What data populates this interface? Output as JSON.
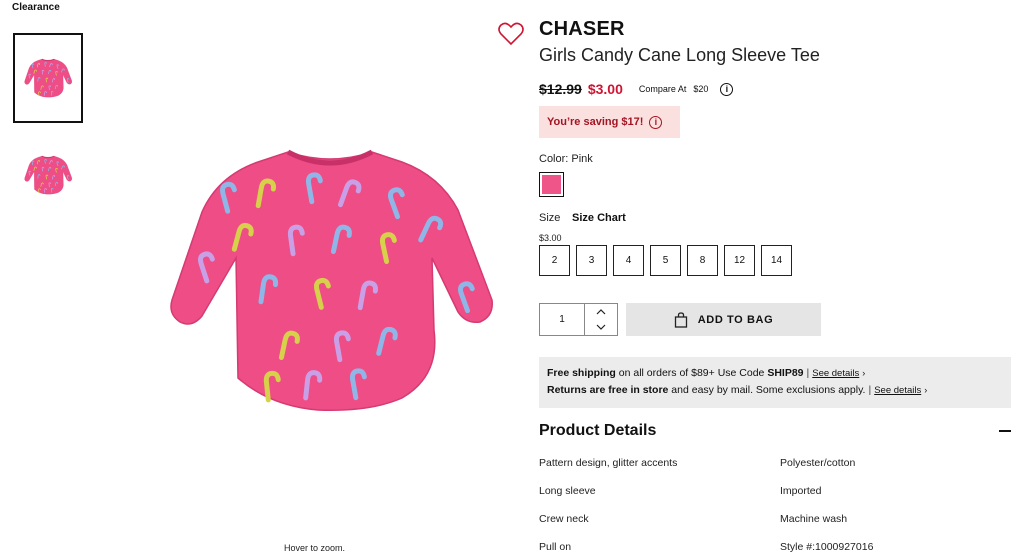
{
  "breadcrumb": "Clearance",
  "product": {
    "brand": "CHASER",
    "title": "Girls Candy Cane Long Sleeve Tee",
    "old_price": "$12.99",
    "new_price": "$3.00",
    "compare_label": "Compare At",
    "compare_value": "$20",
    "saving_text": "You’re saving $17!",
    "color_label": "Color:  Pink",
    "color_hex": "#f0558a",
    "size_label": "Size",
    "size_chart": "Size Chart",
    "size_price": "$3.00",
    "sizes": [
      "2",
      "3",
      "4",
      "5",
      "8",
      "12",
      "14"
    ],
    "quantity": "1",
    "add_to_bag": "ADD TO BAG"
  },
  "gallery": {
    "zoom_hint": "Hover to zoom.",
    "shirt_color": "#ee4d86"
  },
  "promo": {
    "shipping_bold": "Free shipping",
    "shipping_text": " on all orders of $89+ Use Code ",
    "shipping_code": "SHIP89",
    "returns_bold": "Returns are free in store",
    "returns_text": " and easy by mail. Some exclusions apply.",
    "see_details": "See details"
  },
  "details": {
    "title": "Product Details",
    "left": [
      "Pattern design, glitter accents",
      "Long sleeve",
      "Crew neck",
      "Pull on"
    ],
    "right": [
      "Polyester/cotton",
      "Imported",
      "Machine wash",
      "Style #:1000927016"
    ]
  },
  "icons": {
    "wishlist": "heart-outline-icon",
    "info": "info-icon",
    "bag": "shopping-bag-icon",
    "collapse": "minus-icon"
  }
}
